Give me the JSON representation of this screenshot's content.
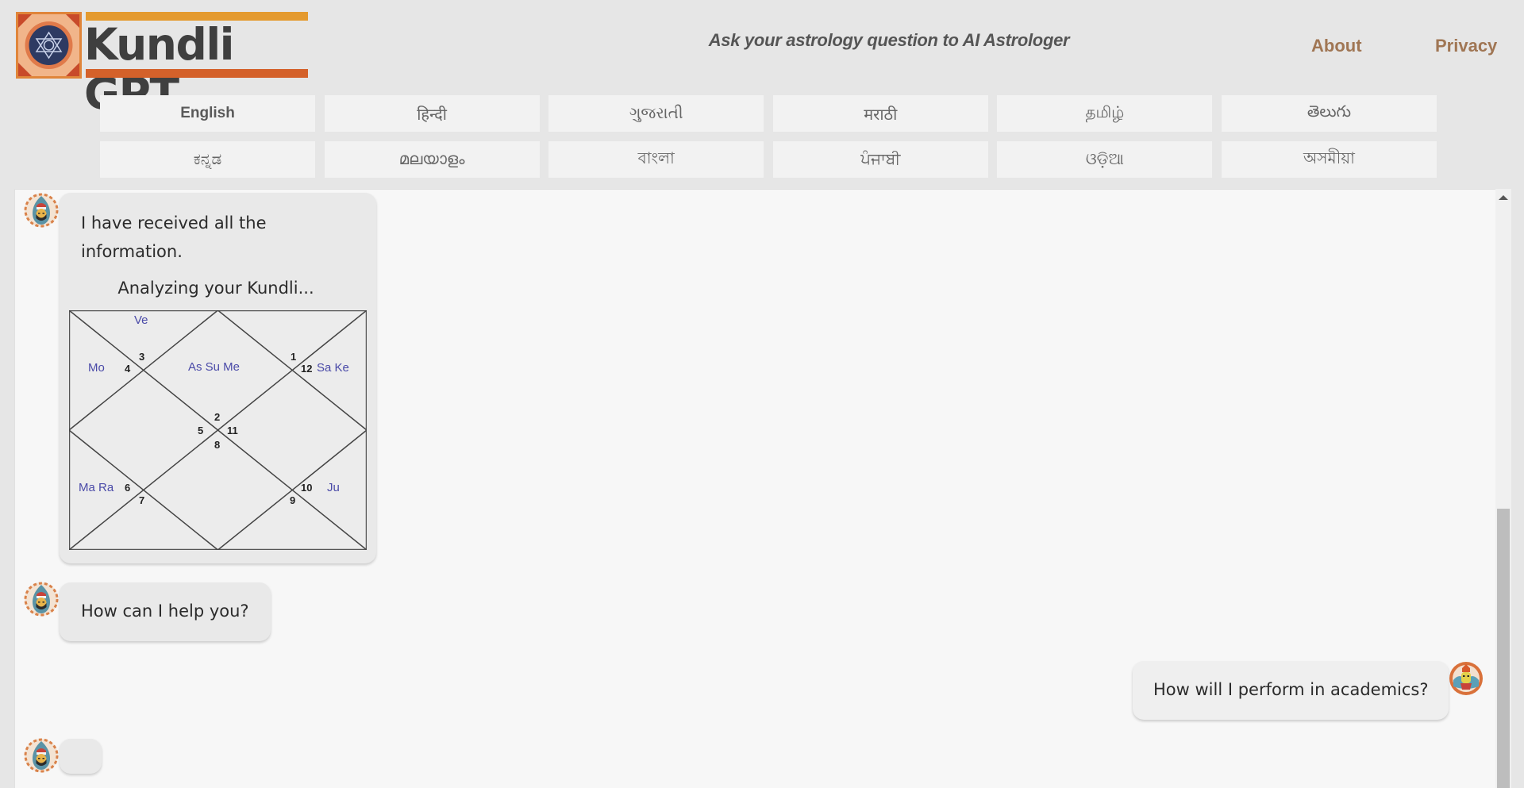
{
  "header": {
    "logo_text": "Kundli GPT",
    "tagline": "Ask your astrology question to AI Astrologer",
    "nav": [
      {
        "label": "About"
      },
      {
        "label": "Privacy"
      }
    ]
  },
  "languages": {
    "selected": "English",
    "items": [
      {
        "label": "English"
      },
      {
        "label": "हिन्दी"
      },
      {
        "label": "ગુજરાતી"
      },
      {
        "label": "मराठी"
      },
      {
        "label": "தமிழ்"
      },
      {
        "label": "తెలుగు"
      },
      {
        "label": "ಕನ್ನಡ"
      },
      {
        "label": "മലയാളം"
      },
      {
        "label": "বাংলা"
      },
      {
        "label": "ਪੰਜਾਬੀ"
      },
      {
        "label": "ଓଡ଼ିଆ"
      },
      {
        "label": "অসমীয়া"
      }
    ]
  },
  "chat": {
    "messages": [
      {
        "sender": "bot",
        "text": "I have received all the information.",
        "subtext": "Analyzing your Kundli..."
      },
      {
        "sender": "bot",
        "text": "How can I help you?"
      },
      {
        "sender": "user",
        "text": "How will I perform in academics?"
      },
      {
        "sender": "bot",
        "text": "",
        "status": "typing"
      }
    ]
  },
  "kundli_chart": {
    "houses": [
      {
        "house": 2,
        "planets": "As Su Me"
      },
      {
        "house": 3,
        "planets": "Ve"
      },
      {
        "house": 4,
        "planets": "Mo"
      },
      {
        "house": 6,
        "planets": "Ma Ra"
      },
      {
        "house": 10,
        "planets": "Ju"
      },
      {
        "house": 12,
        "planets": "Sa Ke"
      }
    ],
    "numbers": {
      "n1": "1",
      "n2": "2",
      "n3": "3",
      "n4": "4",
      "n5": "5",
      "n6": "6",
      "n7": "7",
      "n8": "8",
      "n9": "9",
      "n10": "10",
      "n11": "11",
      "n12": "12"
    },
    "labels": {
      "ve": "Ve",
      "mo": "Mo",
      "assume": "As Su Me",
      "sake": "Sa Ke",
      "mara": "Ma Ra",
      "ju": "Ju"
    }
  },
  "colors": {
    "accent_orange": "#e49a2f",
    "accent_red": "#d4612a",
    "nav_link": "#a07654",
    "planet_text": "#4a4aa8"
  }
}
